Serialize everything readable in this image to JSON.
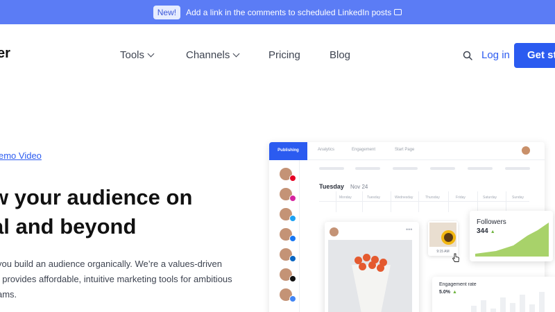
{
  "announcement": {
    "badge": "New!",
    "message": "Add a link in the comments to scheduled LinkedIn posts"
  },
  "logo": {
    "text": "er"
  },
  "nav": {
    "items": [
      {
        "label": "Tools",
        "has_dropdown": true
      },
      {
        "label": "Channels",
        "has_dropdown": true
      },
      {
        "label": "Pricing",
        "has_dropdown": false
      },
      {
        "label": "Blog",
        "has_dropdown": false
      }
    ],
    "search_icon": "search-icon",
    "login": "Log in",
    "cta": "Get sta"
  },
  "hero": {
    "demo_link": "emo Video",
    "headline_line1": "w your audience on",
    "headline_line2": "al and beyond",
    "body_line1": "you build an audience organically. We’re a values-driven",
    "body_line2": "t provides affordable, intuitive marketing tools for ambitious",
    "body_line3": "ams."
  },
  "mockup": {
    "tabs": [
      "Publishing",
      "Analytics",
      "Engagement",
      "Start Page"
    ],
    "active_tab": "Publishing",
    "day": "Tuesday",
    "date": "Nov 24",
    "weekdays": [
      "Monday",
      "Tuesday",
      "Wednesday",
      "Thursday",
      "Friday",
      "Saturday",
      "Sunday"
    ],
    "channels": [
      {
        "icon": "pinterest-icon",
        "color": "#e60023"
      },
      {
        "icon": "instagram-icon",
        "color": "#d6249f"
      },
      {
        "icon": "twitter-icon",
        "color": "#1da1f2"
      },
      {
        "icon": "facebook-icon",
        "color": "#1877f2"
      },
      {
        "icon": "linkedin-icon",
        "color": "#0a66c2"
      },
      {
        "icon": "tiktok-icon",
        "color": "#111111"
      },
      {
        "icon": "googlebusiness-icon",
        "color": "#4285f4"
      }
    ],
    "post_time": "9:15 AM",
    "followers": {
      "title": "Followers",
      "value": "344"
    },
    "engagement": {
      "title": "Engagement rate",
      "value": "5.0%"
    }
  },
  "colors": {
    "announcement_bg": "#5b7cf5",
    "brand_blue": "#2b5bf0",
    "growth_green": "#a8d26a"
  }
}
